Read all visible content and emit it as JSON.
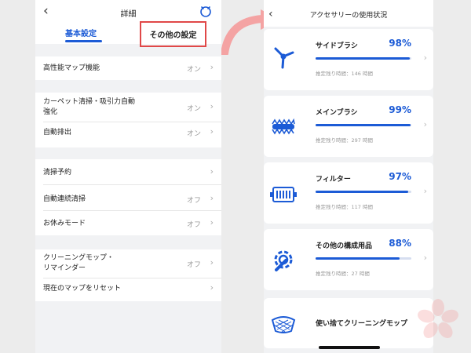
{
  "left": {
    "title": "詳細",
    "tabs": {
      "basic": "基本設定",
      "other": "その他の設定"
    },
    "on": "オン",
    "off": "オフ",
    "rows": {
      "hd_map": "高性能マップ機能",
      "carpet_line1": "カーペット清掃・吸引力自動",
      "carpet_line2": "強化",
      "auto_empty": "自動排出",
      "schedule": "清掃予約",
      "continuous": "自動連続清掃",
      "dnd": "お休みモード",
      "mop_line1": "クリーニングモップ・",
      "mop_line2": "リマインダー",
      "reset_map": "現在のマップをリセット"
    }
  },
  "right": {
    "title": "アクセサリーの使用状況",
    "cards": [
      {
        "name": "サイドブラシ",
        "percent": "98%",
        "level": 0.98,
        "remaining": "推定残り時間：146 時間",
        "icon": "side-brush-icon"
      },
      {
        "name": "メインブラシ",
        "percent": "99%",
        "level": 0.99,
        "remaining": "推定残り時間：297 時間",
        "icon": "main-brush-icon"
      },
      {
        "name": "フィルター",
        "percent": "97%",
        "level": 0.97,
        "remaining": "推定残り時間：117 時間",
        "icon": "filter-icon"
      },
      {
        "name": "その他の構成用品",
        "percent": "88%",
        "level": 0.88,
        "remaining": "推定残り時間：27 時間",
        "icon": "wrench-gear-icon"
      }
    ],
    "disposable": "使い捨てクリーニングモップ"
  },
  "colors": {
    "accent": "#1c5bd6",
    "highlight": "#e04848",
    "arrow": "#f4a3a3"
  }
}
